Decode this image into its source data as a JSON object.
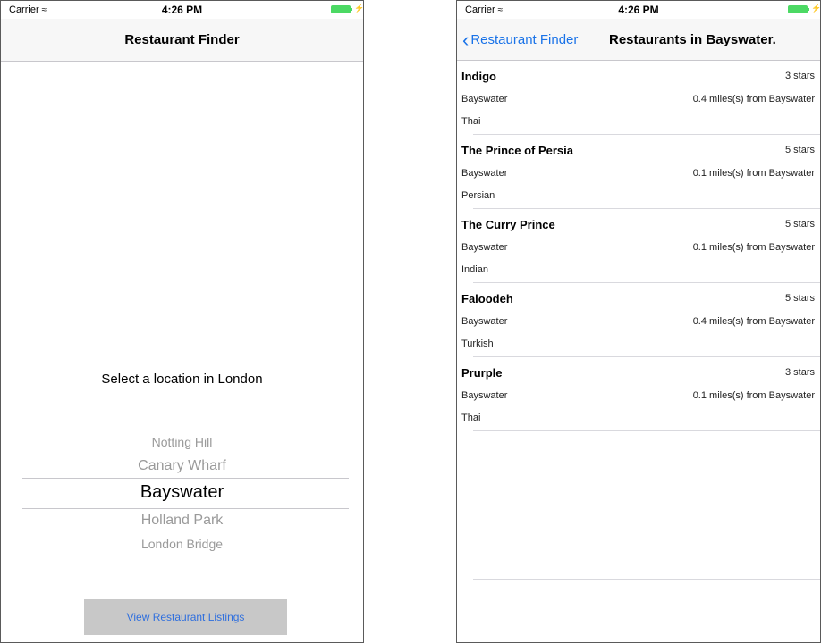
{
  "left_screen": {
    "status_bar": {
      "carrier": "Carrier",
      "time": "4:26 PM"
    },
    "nav": {
      "title": "Restaurant Finder"
    },
    "prompt": "Select a location in London",
    "picker": {
      "options": [
        "Notting Hill",
        "Canary Wharf",
        "Bayswater",
        "Holland Park",
        "London Bridge"
      ],
      "selected": "Bayswater"
    },
    "button": {
      "label": "View Restaurant Listings"
    }
  },
  "right_screen": {
    "status_bar": {
      "carrier": "Carrier",
      "time": "4:26 PM"
    },
    "nav": {
      "back_label": "Restaurant Finder",
      "title": "Restaurants in Bayswater."
    },
    "restaurants": [
      {
        "name": "Indigo",
        "stars": "3 stars",
        "area": "Bayswater",
        "distance": "0.4 miles(s) from Bayswater",
        "cuisine": "Thai"
      },
      {
        "name": "The Prince of Persia",
        "stars": "5 stars",
        "area": "Bayswater",
        "distance": "0.1 miles(s) from Bayswater",
        "cuisine": "Persian"
      },
      {
        "name": "The Curry Prince",
        "stars": "5 stars",
        "area": "Bayswater",
        "distance": "0.1 miles(s) from Bayswater",
        "cuisine": "Indian"
      },
      {
        "name": "Faloodeh",
        "stars": "5 stars",
        "area": "Bayswater",
        "distance": "0.4 miles(s) from Bayswater",
        "cuisine": "Turkish"
      },
      {
        "name": "Prurple",
        "stars": "3 stars",
        "area": "Bayswater",
        "distance": "0.1 miles(s) from Bayswater",
        "cuisine": "Thai"
      }
    ]
  },
  "colors": {
    "tint": "#1a73e8",
    "battery": "#4cd964",
    "button_bg": "#c8c8c8"
  },
  "icons": {
    "wifi": "wifi-icon",
    "battery": "battery-icon",
    "back": "chevron-left-icon"
  }
}
